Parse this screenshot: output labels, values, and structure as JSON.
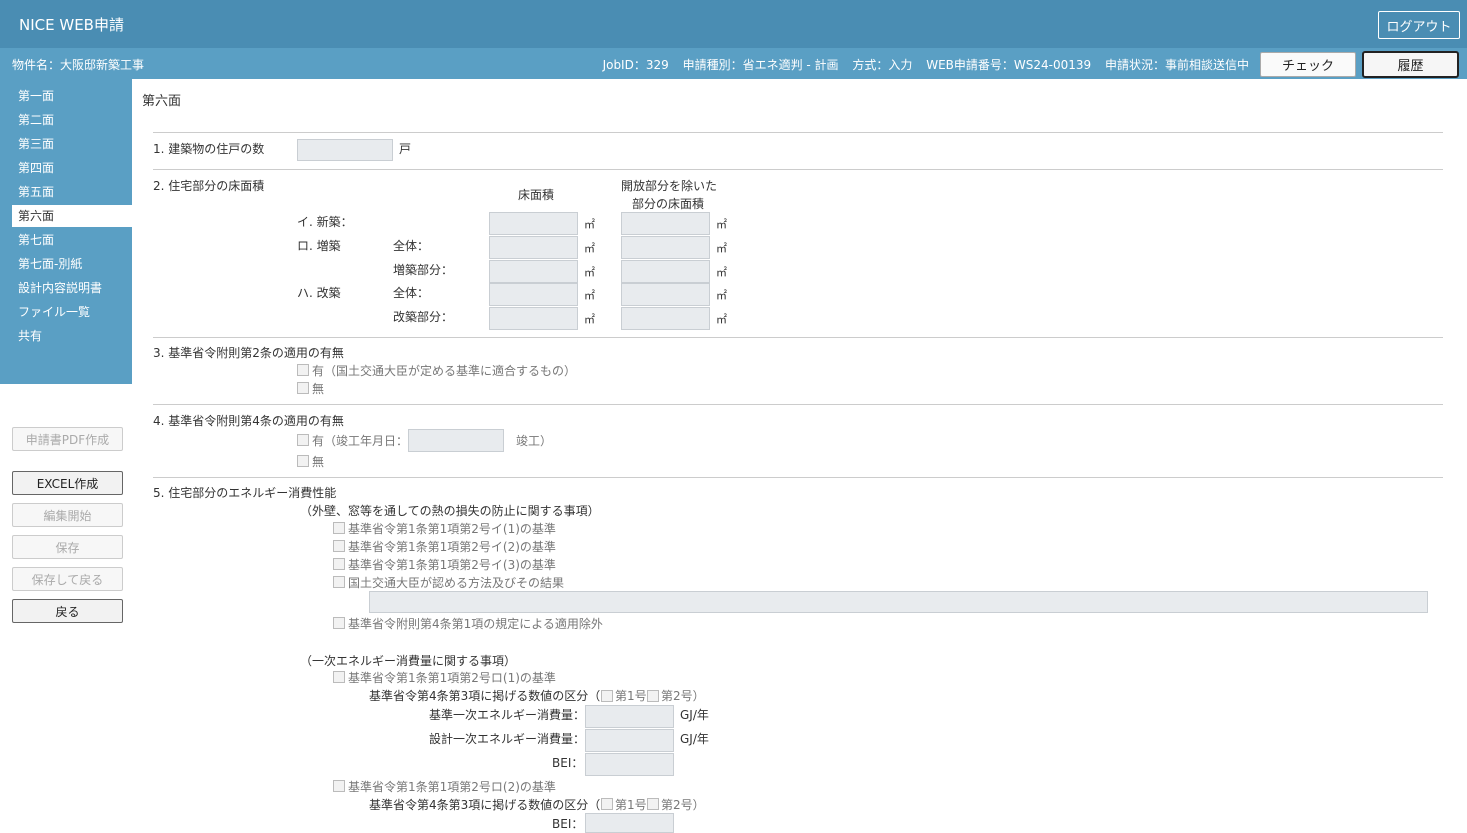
{
  "header": {
    "app_title": "NICE WEB申請",
    "logout": "ログアウト",
    "property": "物件名：大阪邸新築工事",
    "job_id": "JobID：329",
    "app_type": "申請種別：省エネ適判 - 計画",
    "method": "方式：入力",
    "web_no": "WEB申請番号：WS24-00139",
    "status": "申請状況：事前相談送信中",
    "check": "チェック",
    "history": "履歴"
  },
  "sidebar": {
    "items": [
      "第一面",
      "第二面",
      "第三面",
      "第四面",
      "第五面",
      "第六面",
      "第七面",
      "第七面-別紙",
      "設計内容説明書",
      "ファイル一覧",
      "共有"
    ],
    "active": "第六面",
    "buttons": {
      "pdf": "申請書PDF作成",
      "excel": "EXCEL作成",
      "edit": "編集開始",
      "save": "保存",
      "save_back": "保存して戻る",
      "back": "戻る"
    }
  },
  "page": {
    "title": "第六面",
    "s1": {
      "label": "1. 建築物の住戸の数",
      "unit": "戸"
    },
    "s2": {
      "label": "2. 住宅部分の床面積",
      "col1": "床面積",
      "col2a": "開放部分を除いた",
      "col2b": "部分の床面積",
      "new": "イ. 新築：",
      "ext": "ロ. 増築",
      "reno": "ハ. 改築",
      "whole": "全体：",
      "ext_part": "増築部分：",
      "reno_part": "改築部分：",
      "unit": "㎡"
    },
    "s3": {
      "label": "3. 基準省令附則第2条の適用の有無",
      "yes": "有（国土交通大臣が定める基準に適合するもの）",
      "no": "無"
    },
    "s4": {
      "label": "4. 基準省令附則第4条の適用の有無",
      "yes": "有（竣工年月日：",
      "suffix": "竣工）",
      "no": "無"
    },
    "s5": {
      "label": "5. 住宅部分のエネルギー消費性能",
      "sub1": "（外壁、窓等を通しての熱の損失の防止に関する事項）",
      "c1": "基準省令第1条第1項第2号イ(1)の基準",
      "c2": "基準省令第1条第1項第2号イ(2)の基準",
      "c3": "基準省令第1条第1項第2号イ(3)の基準",
      "c4": "国土交通大臣が認める方法及びその結果",
      "c5": "基準省令附則第4条第1項の規定による適用除外",
      "sub2": "（一次エネルギー消費量に関する事項）",
      "d1": "基準省令第1条第1項第2号ロ(1)の基準",
      "category": "基準省令第4条第3項に掲げる数値の区分（",
      "no1": "第1号",
      "no2": "第2号）",
      "std_energy": "基準一次エネルギー消費量：",
      "design_energy": "設計一次エネルギー消費量：",
      "unit_gj": "GJ/年",
      "bei": "BEI：",
      "d2": "基準省令第1条第1項第2号ロ(2)の基準"
    }
  }
}
